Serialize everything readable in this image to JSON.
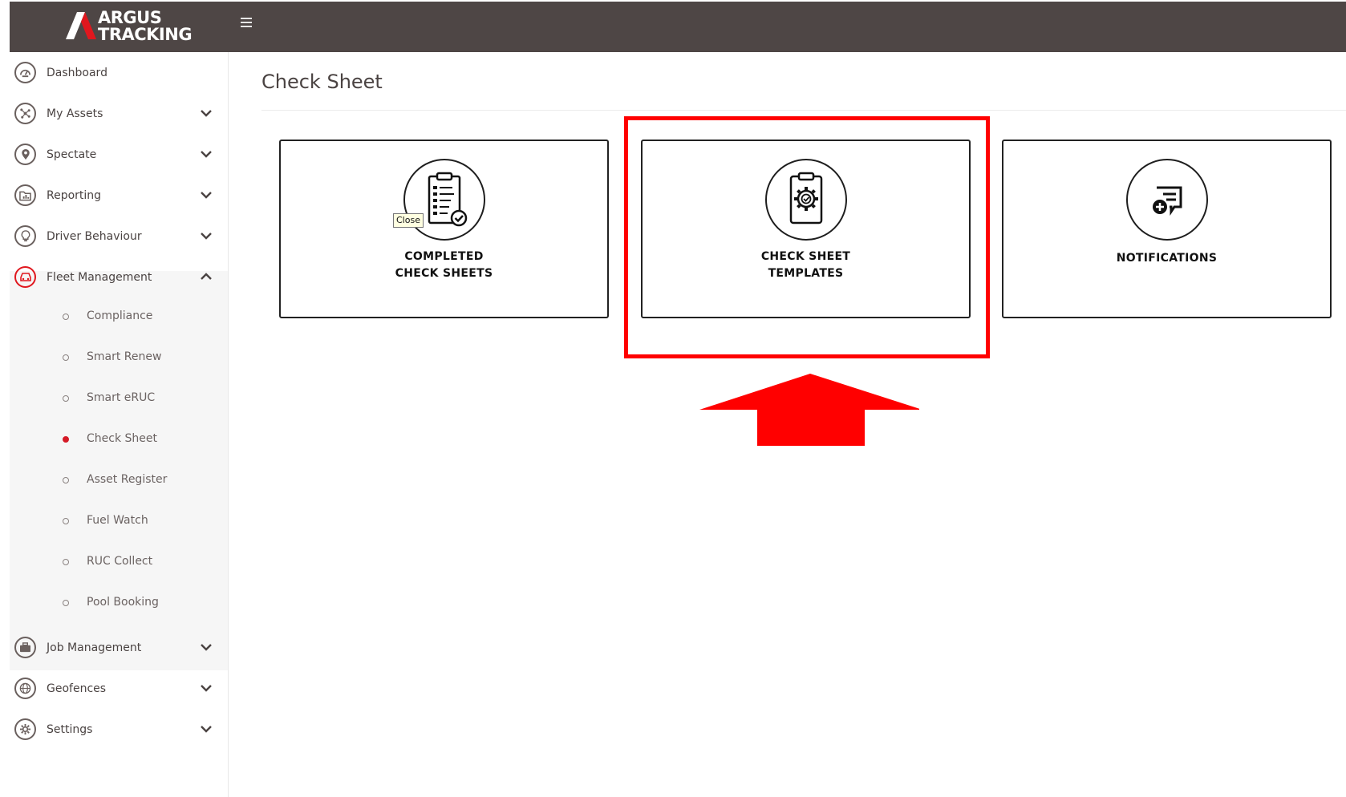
{
  "header": {
    "logo_line1": "ARGUS",
    "logo_line2": "TRACKING",
    "menu_icon": "hamburger-icon"
  },
  "sidebar": {
    "items": [
      {
        "label": "Dashboard",
        "icon": "speedometer-icon"
      },
      {
        "label": "My Assets",
        "icon": "network-icon"
      },
      {
        "label": "Spectate",
        "icon": "map-pin-icon"
      },
      {
        "label": "Reporting",
        "icon": "folder-chart-icon"
      },
      {
        "label": "Driver Behaviour",
        "icon": "lightbulb-icon"
      },
      {
        "label": "Fleet Management",
        "icon": "car-icon"
      }
    ],
    "submenu": [
      {
        "label": "Compliance"
      },
      {
        "label": "Smart Renew"
      },
      {
        "label": "Smart eRUC"
      },
      {
        "label": "Check Sheet",
        "active": true
      },
      {
        "label": "Asset Register"
      },
      {
        "label": "Fuel Watch"
      },
      {
        "label": "RUC Collect"
      },
      {
        "label": "Pool Booking"
      }
    ],
    "items_after": [
      {
        "label": "Job Management",
        "icon": "briefcase-icon"
      },
      {
        "label": "Geofences",
        "icon": "globe-icon"
      },
      {
        "label": "Settings",
        "icon": "gear-icon"
      }
    ]
  },
  "main": {
    "title": "Check Sheet",
    "cards": [
      {
        "line1": "COMPLETED",
        "line2": "CHECK SHEETS",
        "icon": "clipboard-check-icon"
      },
      {
        "line1": "CHECK SHEET",
        "line2": "TEMPLATES",
        "icon": "clipboard-gear-icon"
      },
      {
        "line1": "NOTIFICATIONS",
        "line2": "",
        "icon": "message-plus-icon"
      }
    ],
    "tooltip": "Close"
  },
  "colors": {
    "header_bg": "#4e4645",
    "accent_red": "#d51a27",
    "highlight_red": "#ff0000",
    "submenu_bg": "#f6f6f6"
  }
}
